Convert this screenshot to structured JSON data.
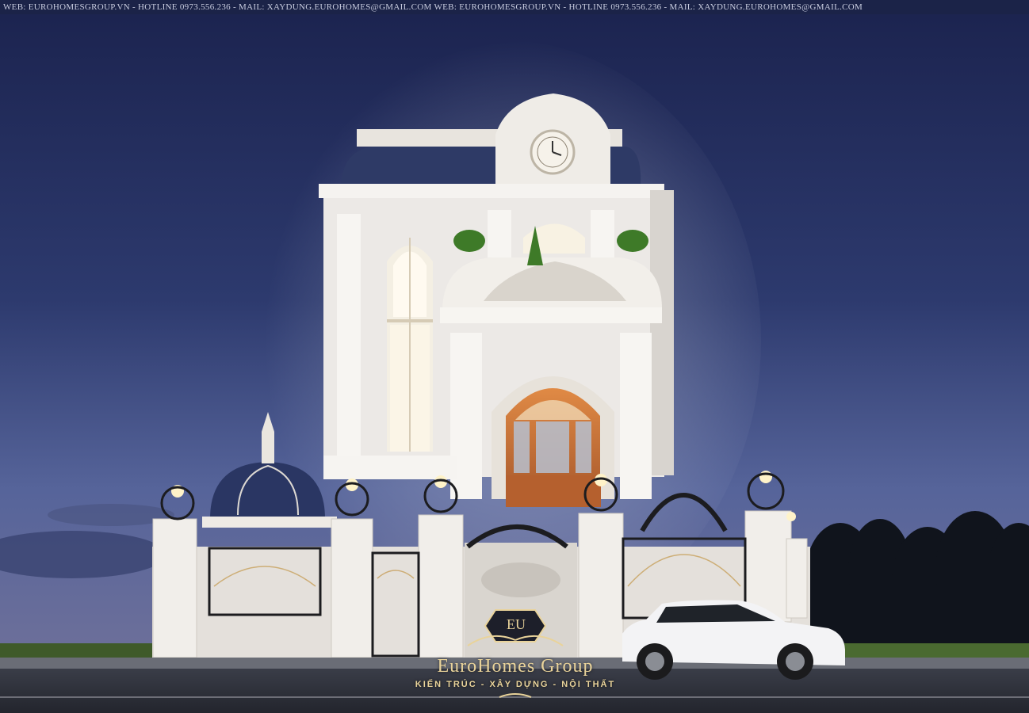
{
  "banner": {
    "text": "WEB: EUROHOMESGROUP.VN - HOTLINE 0973.556.236 - MAIL: XAYDUNG.EUROHOMES@GMAIL.COM   WEB: EUROHOMESGROUP.VN - HOTLINE 0973.556.236 - MAIL: XAYDUNG.EUROHOMES@GMAIL.COM"
  },
  "logo": {
    "monogram": "EU",
    "name": "EuroHomes Group",
    "tagline": "KIẾN TRÚC - XÂY DỰNG - NỘI THẤT"
  },
  "colors": {
    "sky_top": "#1c2450",
    "sky_bottom": "#5a6a9a",
    "facade": "#ece9e6",
    "roof": "#2e3a66",
    "door_wood": "#c76a35",
    "logo_gold": "#e9d39a",
    "grass": "#3f5a2a"
  }
}
